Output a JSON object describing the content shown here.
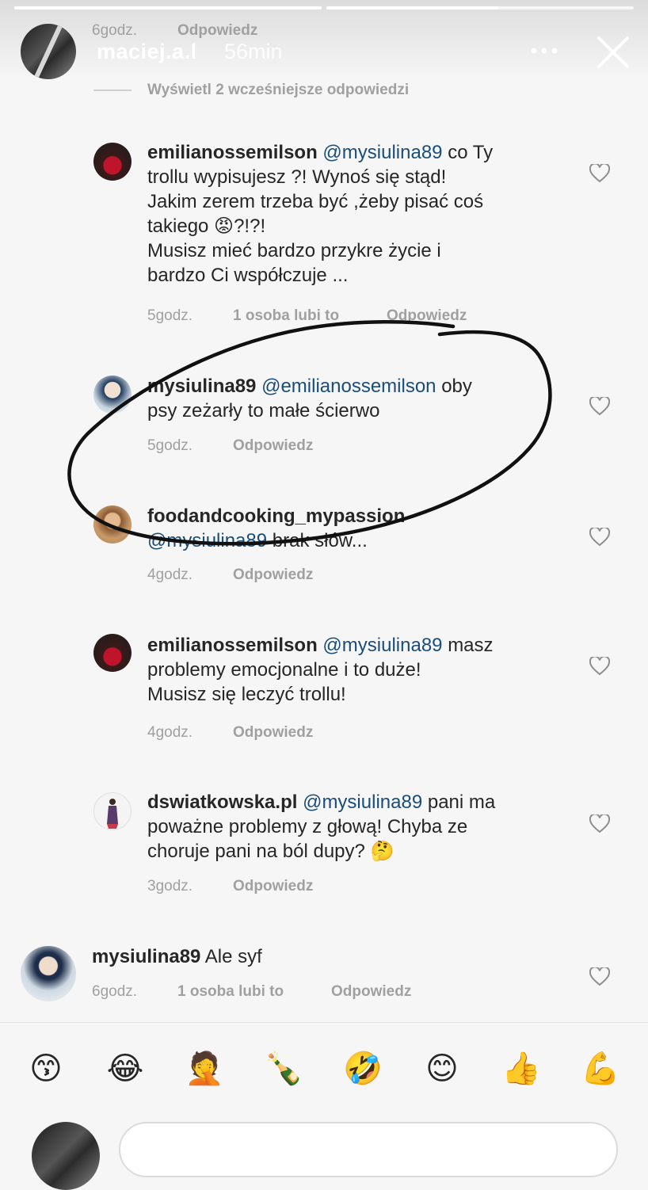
{
  "story": {
    "username": "maciej.a.l",
    "time": "56min",
    "progress": [
      1.0,
      0.56
    ],
    "top_meta_time": "6godz.",
    "top_meta_reply": "Odpowiedz"
  },
  "view_earlier": "Wyświetl 2 wcześniejsze odpowiedzi",
  "comments": [
    {
      "user": "emilianossemilson",
      "mention": "@mysiulina89",
      "lines": [
        "co Ty",
        "trollu wypisujesz ?! Wynoś się stąd!",
        "Jakim zerem trzeba być ,żeby pisać coś",
        "takiego 😡?!?!",
        "Musisz mieć bardzo przykre życie i",
        "bardzo Ci współczuje ..."
      ],
      "time": "5godz.",
      "likes": "1 osoba lubi to",
      "reply": "Odpowiedz"
    },
    {
      "user": "mysiulina89",
      "mention": "@emilianossemilson",
      "lines": [
        "oby",
        "psy zeżarły to małe ścierwo"
      ],
      "time": "5godz.",
      "reply": "Odpowiedz"
    },
    {
      "user": "foodandcooking_mypassion",
      "mention": "@mysiulina89",
      "lines": [
        "brak słów..."
      ],
      "time": "4godz.",
      "reply": "Odpowiedz"
    },
    {
      "user": "emilianossemilson",
      "mention": "@mysiulina89",
      "lines": [
        "masz",
        "problemy emocjonalne i to duże!",
        "Musisz się leczyć trollu!"
      ],
      "time": "4godz.",
      "reply": "Odpowiedz"
    },
    {
      "user": "dswiatkowska.pl",
      "mention": "@mysiulina89",
      "lines": [
        "pani ma",
        "poważne problemy z głową! Chyba ze",
        "choruje pani na ból dupy? 🤔"
      ],
      "time": "3godz.",
      "reply": "Odpowiedz"
    }
  ],
  "parent_comment": {
    "user": "mysiulina89",
    "text": "Ale syf",
    "time": "6godz.",
    "likes": "1 osoba lubi to",
    "reply": "Odpowiedz"
  },
  "emoji_bar": [
    "😙",
    "😂",
    "🤦",
    "🍾",
    "🤣",
    "😊",
    "👍",
    "💪"
  ],
  "colors": {
    "mention": "#1a4d7a",
    "meta": "#a0a0a0",
    "annotation": "#111111"
  }
}
